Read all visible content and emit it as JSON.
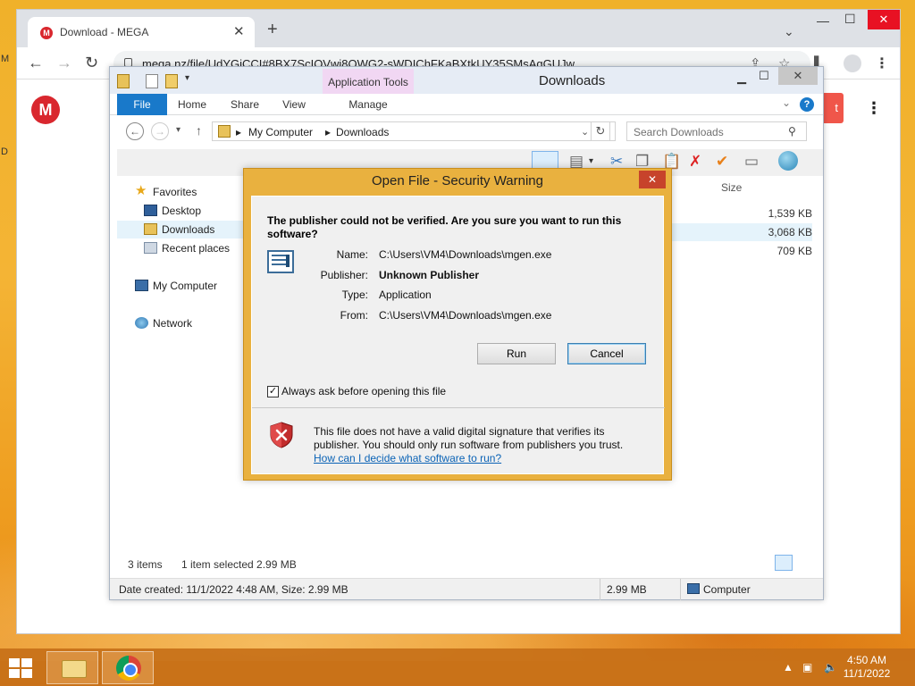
{
  "desktop": {
    "edge_letters": [
      "M",
      "D"
    ]
  },
  "browser": {
    "tab": {
      "title": "Download - MEGA",
      "favicon": "M"
    },
    "new_tab": "+",
    "address": "mega.nz/file/UdYGiCCI#8BX7ScIOVwi8OWG2-sWDIChFKaBXtkUY35SMsAgGUJw",
    "site": {
      "logo": "M",
      "button_tail": "t"
    }
  },
  "explorer": {
    "title": "Downloads",
    "app_tools_label": "Application Tools",
    "ribbon_tabs": [
      "File",
      "Home",
      "Share",
      "View",
      "Manage"
    ],
    "breadcrumb": [
      "My Computer",
      "Downloads"
    ],
    "search_placeholder": "Search Downloads",
    "nav": {
      "favorites": "Favorites",
      "desktop": "Desktop",
      "downloads": "Downloads",
      "recent": "Recent places",
      "computer": "My Computer",
      "network": "Network"
    },
    "files": {
      "size_header": "Size",
      "rows": [
        {
          "size": "1,539 KB"
        },
        {
          "size": "3,068 KB"
        },
        {
          "size": "709 KB"
        }
      ]
    },
    "status": {
      "items": "3 items",
      "selected": "1 item selected  2.99 MB",
      "bar_left": "Date created: 11/1/2022 4:48 AM, Size: 2.99 MB",
      "bar_size": "2.99 MB",
      "bar_location": "Computer"
    }
  },
  "dialog": {
    "title": "Open File - Security Warning",
    "question": "The publisher could not be verified.  Are you sure you want to run this software?",
    "fields": [
      {
        "key": "Name:",
        "value": "C:\\Users\\VM4\\Downloads\\mgen.exe"
      },
      {
        "key": "Publisher:",
        "value": "Unknown Publisher"
      },
      {
        "key": "Type:",
        "value": "Application"
      },
      {
        "key": "From:",
        "value": "C:\\Users\\VM4\\Downloads\\mgen.exe"
      }
    ],
    "run": "Run",
    "cancel": "Cancel",
    "always_ask": "Always ask before opening this file",
    "always_ask_checked": true,
    "warning": "This file does not have a valid digital signature that verifies its publisher.  You should only run software from publishers you trust.",
    "link": "How can I decide what software to run?"
  },
  "taskbar": {
    "time": "4:50 AM",
    "date": "11/1/2022"
  }
}
